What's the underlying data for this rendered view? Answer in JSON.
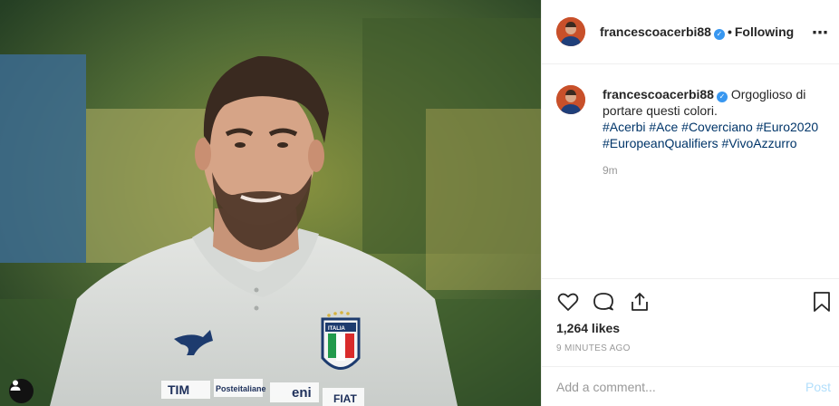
{
  "post": {
    "username": "francescoacerbi88",
    "verified_mark": "✓",
    "separator": "•",
    "follow_status": "Following",
    "more_icon": "⋯",
    "caption_text": "Orgoglioso di portare questi colori.",
    "hashtags": "#Acerbi #Ace #Coverciano #Euro2020 #EuropeanQualifiers #VivoAzzurro",
    "relative_time": "9m",
    "likes": "1,264 likes",
    "time_ago": "9 MINUTES AGO",
    "comment_placeholder": "Add a comment...",
    "post_label": "Post"
  },
  "photo": {
    "shirt_logos": [
      "TIM",
      "Posteitaliane",
      "eni",
      "FIAT"
    ],
    "crest_text": "ITALIA"
  },
  "icons": [
    "heart-icon",
    "comment-icon",
    "share-icon",
    "bookmark-icon",
    "user-tag-icon",
    "more-options-icon",
    "verified-icon"
  ],
  "colors": {
    "link": "#003569",
    "verified": "#3897f0",
    "muted": "#999999",
    "post_disabled": "#b2dffc"
  }
}
